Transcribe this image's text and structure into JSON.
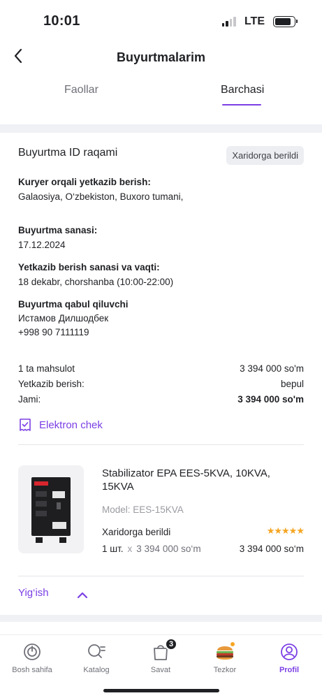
{
  "status_bar": {
    "time": "10:01",
    "network": "LTE"
  },
  "header": {
    "title": "Buyurtmalarim"
  },
  "tabs": [
    {
      "label": "Faollar",
      "active": false
    },
    {
      "label": "Barchasi",
      "active": true
    }
  ],
  "order": {
    "id_label": "Buyurtma ID raqami",
    "status": "Xaridorga berildi",
    "delivery_method_label": "Kuryer orqali yetkazib berish:",
    "delivery_address": "Galaosiya, O‘zbekiston, Buxoro tumani,",
    "order_date_label": "Buyurtma sanasi:",
    "order_date": "17.12.2024",
    "delivery_date_label": "Yetkazib berish sanasi va vaqti:",
    "delivery_date": "18 dekabr, chorshanba (10:00-22:00)",
    "recipient_label": "Buyurtma qabul qiluvchi",
    "recipient_name": "Истамов Дилшодбек",
    "recipient_phone": "+998 90 7111119"
  },
  "summary": {
    "items_label": "1 ta mahsulot",
    "items_value": "3 394 000 so'm",
    "delivery_label": "Yetkazib berish:",
    "delivery_value": "bepul",
    "total_label": "Jami:",
    "total_value": "3 394 000 so'm"
  },
  "echek_label": "Elektron chek",
  "product": {
    "name": "Stabilizator EPA EES-5KVA, 10KVA, 15KVA",
    "model": "Model: EES-15KVA",
    "status": "Xaridorga berildi",
    "rating": 5,
    "stars": "★★★★★",
    "qty": "1 шт.",
    "x": "x",
    "unit_price": "3 394 000 so‘m",
    "total": "3 394 000 so‘m"
  },
  "collapse_label": "Yig‘ish",
  "bottom_nav": [
    {
      "label": "Bosh sahifa",
      "icon": "home-power-icon"
    },
    {
      "label": "Katalog",
      "icon": "catalog-search-icon"
    },
    {
      "label": "Savat",
      "icon": "cart-bag-icon",
      "badge": "3"
    },
    {
      "label": "Tezkor",
      "icon": "burger-icon"
    },
    {
      "label": "Profil",
      "icon": "profile-icon",
      "active": true
    }
  ],
  "colors": {
    "accent": "#7b3fe4",
    "star": "#f5a623",
    "band": "#f0f1f5"
  }
}
